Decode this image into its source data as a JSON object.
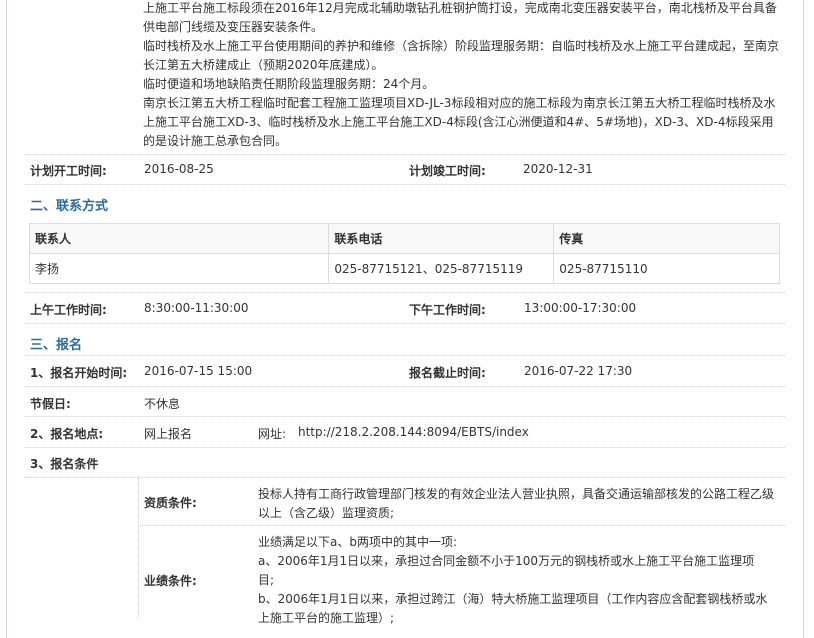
{
  "intro": {
    "lines": [
      "上施工平台施工标段须在2016年12月完成北辅助墩钻孔桩钢护筒打设，完成南北变压器安装平台，南北栈桥及平台具备",
      "供电部门线缆及变压器安装条件。",
      "临时栈桥及水上施工平台使用期间的养护和维修（含拆除）阶段监理服务期：自临时栈桥及水上施工平台建成起，至南京",
      "长江第五大桥建成止（预期2020年底建成）。",
      "临时便道和场地缺陷责任期阶段监理服务期：24个月。",
      "南京长江第五大桥工程临时配套工程施工监理项目XD-JL-3标段相对应的施工标段为南京长江第五大桥工程临时栈桥及水",
      "上施工平台施工XD-3、临时栈桥及水上施工平台施工XD-4标段(含江心洲便道和4#、5#场地)，XD-3、XD-4标段采用",
      "的是设计施工总承包合同。"
    ]
  },
  "schedule": {
    "start_label": "计划开工时间:",
    "start_value": "2016-08-25",
    "end_label": "计划竣工时间:",
    "end_value": "2020-12-31"
  },
  "section2": {
    "title": "二、联系方式",
    "headers": [
      "联系人",
      "联系电话",
      "传真"
    ],
    "row": [
      "李扬",
      "025-87715121、025-87715119",
      "025-87715110"
    ],
    "am_label": "上午工作时间:",
    "am_value": "8:30:00-11:30:00",
    "pm_label": "下午工作时间:",
    "pm_value": "13:00:00-17:30:00"
  },
  "section3": {
    "title": "三、报名",
    "start_label": "1、报名开始时间:",
    "start_value": "2016-07-15 15:00",
    "end_label": "报名截止时间:",
    "end_value": "2016-07-22 17:30",
    "holiday_label": "节假日:",
    "holiday_value": "不休息",
    "place_label": "2、报名地点:",
    "place_value": "网上报名",
    "url_label": "网址:",
    "url_value": "http://218.2.208.144:8094/EBTS/index",
    "cond_label": "3、报名条件",
    "qual_label": "资质条件:",
    "qual_lines": [
      "投标人持有工商行政管理部门核发的有效企业法人营业执照，具备交通运输部核发的公路工程乙级",
      "以上（含乙级）监理资质;"
    ],
    "perf_label": "业绩条件:",
    "perf_lines": [
      "业绩满足以下a、b两项中的其中一项:",
      "a、2006年1月1日以来，承担过合同金额不小于100万元的钢栈桥或水上施工平台施工监理项",
      "目;",
      "b、2006年1月1日以来，承担过跨江（海）特大桥施工监理项目（工作内容应含配套钢栈桥或水",
      "上施工平台的施工监理）;"
    ]
  }
}
